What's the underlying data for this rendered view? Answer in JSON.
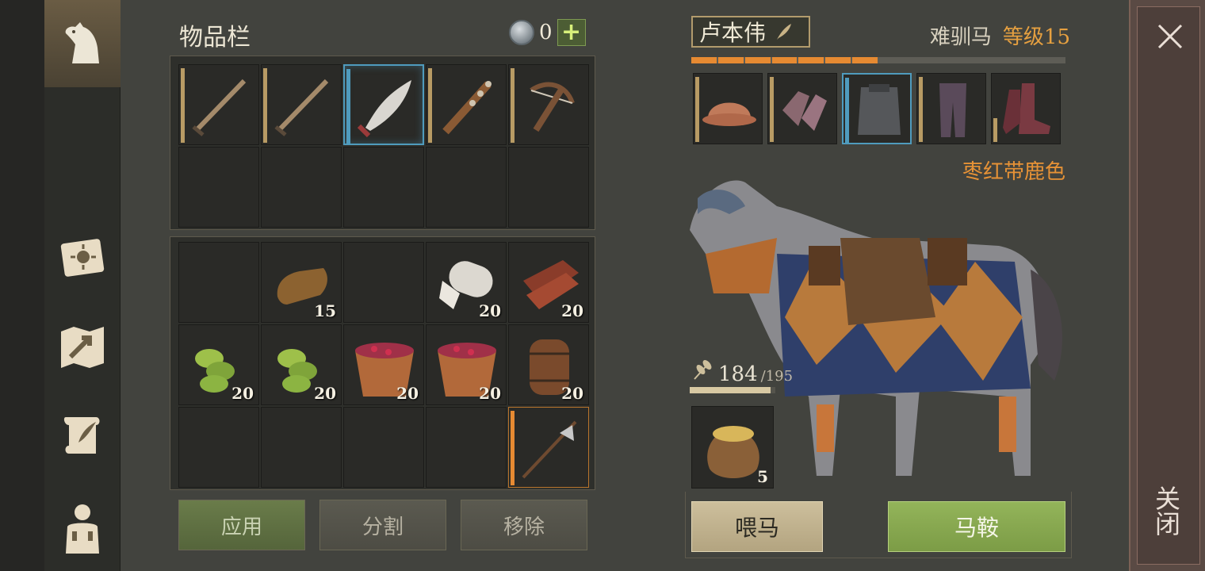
{
  "inventory": {
    "title": "物品栏",
    "currency_value": "0",
    "add_label": "+",
    "counts": {
      "b1": "15",
      "b3": "20",
      "b4": "20",
      "c0": "20",
      "c1": "20",
      "c2": "20",
      "c3": "20",
      "c4": "20",
      "d4": ""
    },
    "buttons": {
      "apply": "应用",
      "split": "分割",
      "remove": "移除"
    }
  },
  "horse": {
    "name": "卢本伟",
    "type": "难驯马",
    "level": "等级15",
    "xp_filled_fraction": 0.47,
    "coat": "枣红带鹿色",
    "food_value": "184",
    "food_max": "/195",
    "food_fraction": 0.94,
    "feed_count": "5",
    "buttons": {
      "feed": "喂马",
      "saddle": "马鞍"
    }
  },
  "close_label": "关闭",
  "colors": {
    "accent_orange": "#e68a32",
    "selected_blue": "#4f9bbd",
    "apply_green": "#6a7c4a",
    "saddle_green": "#93b45a"
  },
  "icons": {
    "weapons": [
      "sword-icon",
      "sword-icon",
      "scimitar-icon",
      "spiked-club-icon",
      "crossbow-icon"
    ],
    "consumables": [
      "bread-loaf-icon",
      "cloth-roll-icon",
      "leather-icon",
      "herb-icon",
      "herb-icon",
      "berry-bucket-icon",
      "berry-bucket-icon",
      "barrel-icon",
      "halberd-icon"
    ],
    "gear": [
      "helmet-icon",
      "mail-gloves-icon",
      "scale-armor-icon",
      "leggings-icon",
      "boots-icon"
    ],
    "feed": "grain-sack-icon"
  }
}
